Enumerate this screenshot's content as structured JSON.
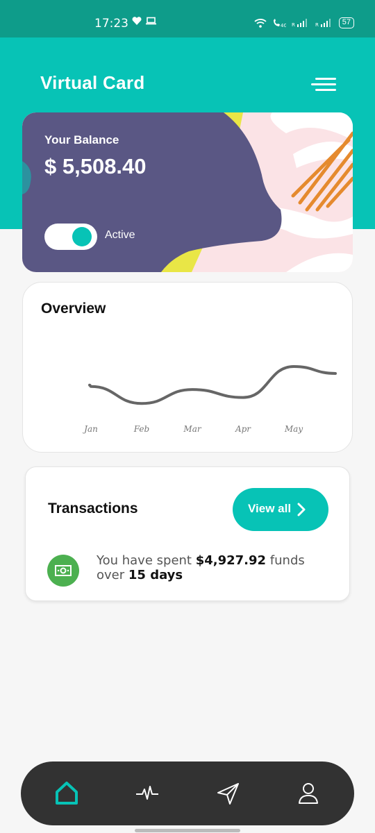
{
  "status_bar": {
    "time": "17:23",
    "battery": "57",
    "icons": [
      "heart-icon",
      "laptop-icon",
      "wifi-icon",
      "call-icon",
      "signal-icon",
      "signal-icon",
      "battery-icon"
    ]
  },
  "header": {
    "title": "Virtual Card"
  },
  "balance_card": {
    "label": "Your Balance",
    "amount": "$ 5,508.40",
    "toggle_label": "Active",
    "toggle_on": true
  },
  "overview": {
    "title": "Overview"
  },
  "chart_data": {
    "type": "line",
    "categories": [
      "Jan",
      "Feb",
      "Mar",
      "Apr",
      "May"
    ],
    "x_tick_labels": [
      "Jan",
      "Feb",
      "Mar",
      "Apr",
      "May"
    ],
    "series": [
      {
        "values": [
          0.42,
          0.08,
          0.36,
          0.2,
          0.82
        ],
        "color": "#666666"
      }
    ],
    "grid": false,
    "legend": "none"
  },
  "transactions": {
    "title": "Transactions",
    "view_all_label": "View all",
    "summary_prefix": "You have spent ",
    "summary_amount": "$4,927.92",
    "summary_middle": " funds over ",
    "summary_period": "15 days"
  },
  "bottom_nav": {
    "items": [
      "home-icon",
      "activity-icon",
      "send-icon",
      "profile-icon"
    ],
    "active_index": 0
  },
  "colors": {
    "teal": "#07c3b6",
    "status_teal": "#0e9c8a",
    "card_purple": "#5a5784",
    "yellow": "#e9e646",
    "orange": "#e58a2e",
    "pink": "#fbe3e6",
    "green": "#4cb050",
    "nav_dark": "#323232"
  }
}
